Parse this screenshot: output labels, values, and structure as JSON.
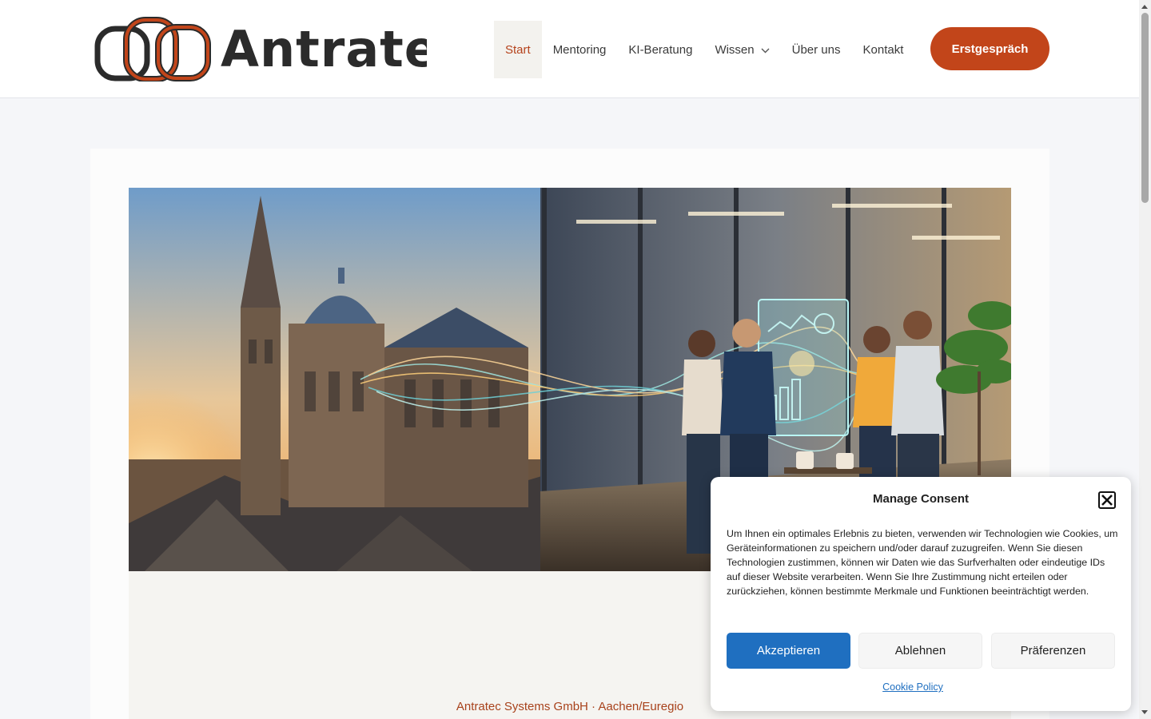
{
  "header": {
    "logo_text": "Antratec",
    "nav": [
      {
        "label": "Start",
        "active": true
      },
      {
        "label": "Mentoring"
      },
      {
        "label": "KI-Beratung"
      },
      {
        "label": "Wissen",
        "has_dropdown": true
      },
      {
        "label": "Über uns"
      },
      {
        "label": "Kontakt"
      }
    ],
    "cta_label": "Erstgespräch"
  },
  "main": {
    "company_line": "Antratec Systems GmbH · Aachen/Euregio"
  },
  "consent": {
    "title": "Manage Consent",
    "text": "Um Ihnen ein optimales Erlebnis zu bieten, verwenden wir Technologien wie Cookies, um Geräteinformationen zu speichern und/oder darauf zuzugreifen. Wenn Sie diesen Technologien zustimmen, können wir Daten wie das Surfverhalten oder eindeutige IDs auf dieser Website verarbeiten. Wenn Sie Ihre Zustimmung nicht erteilen oder zurückziehen, können bestimmte Merkmale und Funktionen beeinträchtigt werden.",
    "accept_label": "Akzeptieren",
    "deny_label": "Ablehnen",
    "preferences_label": "Präferenzen",
    "policy_link": "Cookie Policy"
  },
  "colors": {
    "brand": "#c2451a",
    "accent_blue": "#1f6fc0",
    "logo_dark": "#2b2b2b"
  }
}
